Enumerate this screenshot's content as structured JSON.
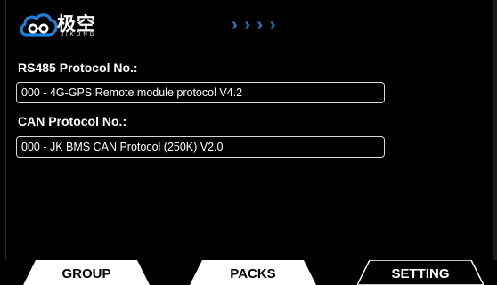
{
  "header": {
    "logo_cn": "极空",
    "logo_en": "JIKONG",
    "arrows": "› › › ›"
  },
  "rs485": {
    "label": "RS485 Protocol No.:",
    "value": "000 - 4G-GPS Remote module protocol V4.2"
  },
  "can": {
    "label": "CAN Protocol No.:",
    "value": "000 - JK BMS CAN Protocol (250K) V2.0"
  },
  "tabs": [
    {
      "label": "GROUP",
      "active": false
    },
    {
      "label": "PACKS",
      "active": false
    },
    {
      "label": "SETTING",
      "active": true
    }
  ],
  "colors": {
    "background": "#000000",
    "accent": "#1e7fd8",
    "tab_inactive": "#ffffff",
    "tab_active": "#000000"
  }
}
